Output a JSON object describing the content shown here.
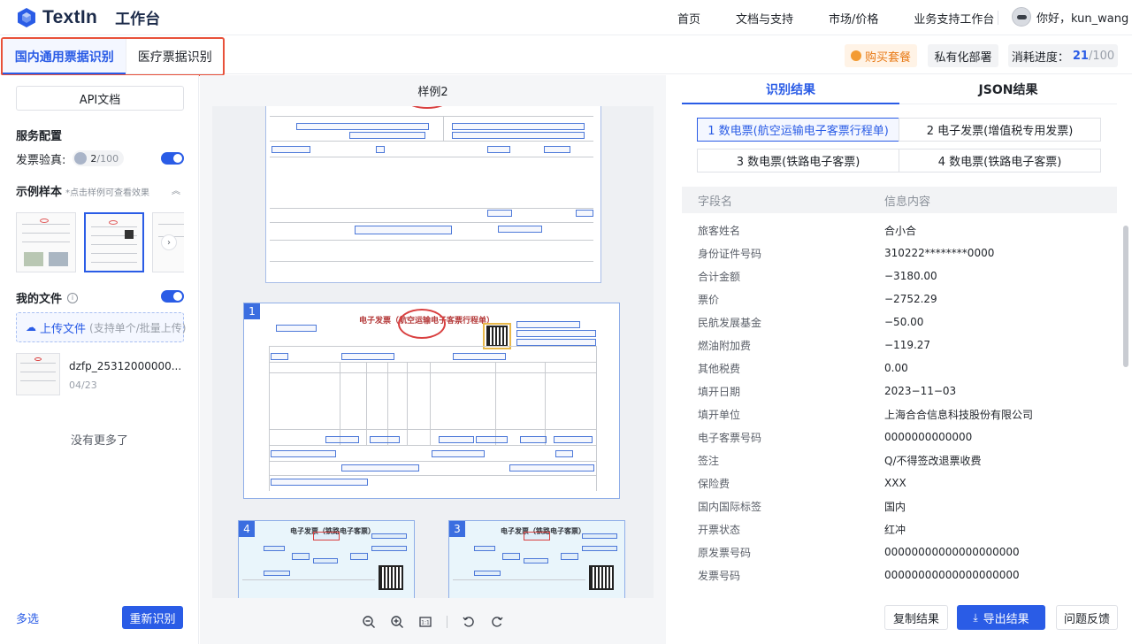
{
  "header": {
    "logo_text": "TextIn",
    "product": "工作台",
    "nav": [
      "首页",
      "文档与支持",
      "市场/价格",
      "业务支持工作台"
    ],
    "user_greeting": "你好，kun_wang"
  },
  "subbar": {
    "tabs": [
      {
        "label": "国内通用票据识别",
        "active": true
      },
      {
        "label": "医疗票据识别",
        "active": false
      }
    ],
    "buy_label": "购买套餐",
    "private_label": "私有化部署",
    "progress_label": "消耗进度：",
    "progress_used": "21",
    "progress_sep": " / ",
    "progress_total": "100"
  },
  "left": {
    "api_doc": "API文档",
    "service_config": "服务配置",
    "verify_label": "发票验真:",
    "verify_used": "2",
    "verify_total": "/100",
    "verify_on": true,
    "samples_title": "示例样本",
    "samples_hint": "*点击样例可查看效果",
    "my_files": "我的文件",
    "my_files_on": true,
    "upload_main": "上传文件",
    "upload_sub": "(支持单个/批量上传)",
    "file": {
      "name": "dzfp_25312000000...",
      "date": "04/23"
    },
    "no_more": "没有更多了",
    "multi_select": "多选",
    "rescan": "重新识别"
  },
  "center": {
    "title": "样例2",
    "doc_badges": [
      "1",
      "4",
      "3"
    ],
    "doc1_title": "电子发票（航空运输电子客票行程单）",
    "rail_title": "电子发票（铁路电子客票）"
  },
  "right": {
    "tabs": [
      {
        "label": "识别结果",
        "active": true
      },
      {
        "label": "JSON结果",
        "active": false
      }
    ],
    "invoice_tabs": [
      {
        "label": "1 数电票(航空运输电子客票行程单)",
        "active": true
      },
      {
        "label": "2 电子发票(增值税专用发票)",
        "active": false
      },
      {
        "label": "3 数电票(铁路电子客票)",
        "active": false
      },
      {
        "label": "4 数电票(铁路电子客票)",
        "active": false
      }
    ],
    "col_field": "字段名",
    "col_value": "信息内容",
    "rows": [
      {
        "k": "旅客姓名",
        "v": "合小合"
      },
      {
        "k": "身份证件号码",
        "v": "310222********0000"
      },
      {
        "k": "合计金额",
        "v": "−3180.00"
      },
      {
        "k": "票价",
        "v": "−2752.29"
      },
      {
        "k": "民航发展基金",
        "v": "−50.00"
      },
      {
        "k": "燃油附加费",
        "v": "−119.27"
      },
      {
        "k": "其他税费",
        "v": "0.00"
      },
      {
        "k": "填开日期",
        "v": "2023−11−03"
      },
      {
        "k": "填开单位",
        "v": "上海合合信息科技股份有限公司"
      },
      {
        "k": "电子客票号码",
        "v": "0000000000000"
      },
      {
        "k": "签注",
        "v": "Q/不得签改退票收费"
      },
      {
        "k": "保险费",
        "v": "XXX"
      },
      {
        "k": "国内国际标签",
        "v": "国内"
      },
      {
        "k": "开票状态",
        "v": "红冲"
      },
      {
        "k": "原发票号码",
        "v": "00000000000000000000"
      },
      {
        "k": "发票号码",
        "v": "00000000000000000000"
      }
    ],
    "copy": "复制结果",
    "export": "导出结果",
    "feedback": "问题反馈"
  }
}
